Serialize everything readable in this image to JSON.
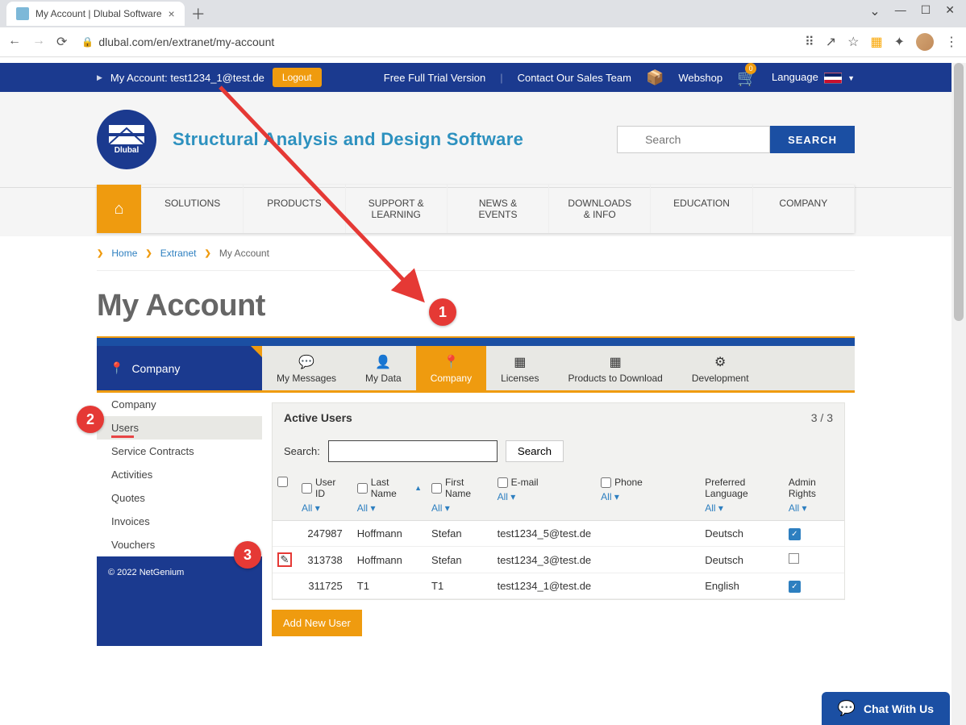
{
  "browser": {
    "tab_title": "My Account | Dlubal Software",
    "url": "dlubal.com/en/extranet/my-account"
  },
  "topbar": {
    "account_label": "My Account: test1234_1@test.de",
    "logout": "Logout",
    "trial": "Free Full Trial Version",
    "contact": "Contact Our Sales Team",
    "webshop": "Webshop",
    "cart_count": "0",
    "language": "Language"
  },
  "brand": {
    "title": "Structural Analysis and Design Software",
    "logo_text": "Dlubal"
  },
  "search": {
    "placeholder": "Search",
    "button": "SEARCH"
  },
  "mainnav": {
    "items": [
      "SOLUTIONS",
      "PRODUCTS",
      "SUPPORT & LEARNING",
      "NEWS & EVENTS",
      "DOWNLOADS & INFO",
      "EDUCATION",
      "COMPANY"
    ]
  },
  "breadcrumb": {
    "items": [
      "Home",
      "Extranet"
    ],
    "current": "My Account"
  },
  "page_title": "My Account",
  "side_tab": {
    "label": "Company"
  },
  "tabs": {
    "items": [
      {
        "label": "My Messages",
        "icon": "💬"
      },
      {
        "label": "My Data",
        "icon": "👤"
      },
      {
        "label": "Company",
        "icon": "📍",
        "active": true
      },
      {
        "label": "Licenses",
        "icon": "▦"
      },
      {
        "label": "Products to Download",
        "icon": "▦"
      },
      {
        "label": "Development",
        "icon": "⚙"
      }
    ]
  },
  "sidebar": {
    "items": [
      "Company",
      "Users",
      "Service Contracts",
      "Activities",
      "Quotes",
      "Invoices",
      "Vouchers"
    ],
    "active_index": 1,
    "copyright": "© 2022 NetGenium"
  },
  "panel": {
    "title": "Active Users",
    "count": "3 / 3",
    "search_label": "Search:",
    "search_button": "Search",
    "columns": {
      "user_id": "User ID",
      "last_name": "Last Name",
      "first_name": "First Name",
      "email": "E-mail",
      "phone": "Phone",
      "pref_lang": "Preferred Language",
      "admin": "Admin Rights"
    },
    "filter_label": "All",
    "rows": [
      {
        "user_id": "247987",
        "last_name": "Hoffmann",
        "first_name": "Stefan",
        "email": "test1234_5@test.de",
        "phone": "",
        "lang": "Deutsch",
        "admin": true
      },
      {
        "user_id": "313738",
        "last_name": "Hoffmann",
        "first_name": "Stefan",
        "email": "test1234_3@test.de",
        "phone": "",
        "lang": "Deutsch",
        "admin": false,
        "edit": true
      },
      {
        "user_id": "311725",
        "last_name": "T1",
        "first_name": "T1",
        "email": "test1234_1@test.de",
        "phone": "",
        "lang": "English",
        "admin": true
      }
    ],
    "add_button": "Add New User"
  },
  "annotations": {
    "c1": "1",
    "c2": "2",
    "c3": "3"
  },
  "chat": {
    "label": "Chat With Us"
  }
}
